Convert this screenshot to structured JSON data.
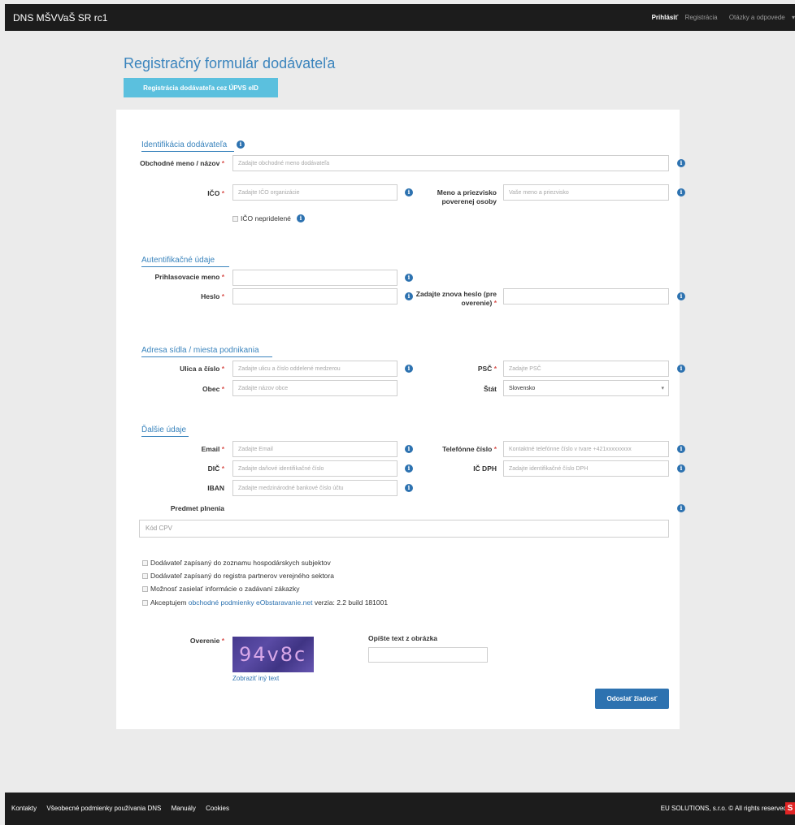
{
  "header": {
    "brand": "DNS MŠVVaŠ SR rc1",
    "nav": [
      "Prihlásiť",
      "Registrácia",
      "Otázky a odpovede"
    ],
    "dropdown_caret": "▾"
  },
  "page": {
    "title": "Registračný formulár dodávateľa",
    "eid_button": "Registrácia dodávateľa cez ÚPVS eID"
  },
  "sections": {
    "identification": {
      "title": "Identifikácia dodávateľa",
      "business_name_label": "Obchodné meno / názov",
      "business_name_placeholder": "Zadajte obchodné meno dodávateľa",
      "ico_label": "IČO",
      "ico_placeholder": "Zadajte IČO organizácie",
      "person_label": "Meno a priezvisko poverenej osoby",
      "person_placeholder": "Vaše meno a priezvisko",
      "ico_unassigned": "IČO nepridelené"
    },
    "auth": {
      "title": "Autentifikačné údaje",
      "login_label": "Prihlasovacie meno",
      "password_label": "Heslo",
      "password_repeat_label": "Zadajte znova heslo (pre overenie)"
    },
    "address": {
      "title": "Adresa sídla / miesta podnikania",
      "street_label": "Ulica a číslo",
      "street_placeholder": "Zadajte ulicu a číslo oddelené medzerou",
      "postal_label": "PSČ",
      "postal_placeholder": "Zadajte PSČ",
      "city_label": "Obec",
      "city_placeholder": "Zadajte názov obce",
      "country_label": "Štát",
      "country_value": "Slovensko"
    },
    "other": {
      "title": "Ďalšie údaje",
      "email_label": "Email",
      "email_placeholder": "Zadajte Email",
      "phone_label": "Telefónne číslo",
      "phone_placeholder": "Kontaktné telefónne číslo v tvare +421xxxxxxxxx",
      "dic_label": "DIČ",
      "dic_placeholder": "Zadajte daňové identifikačné číslo",
      "vat_label": "IČ DPH",
      "vat_placeholder": "Zadajte identifikačné číslo DPH",
      "iban_label": "IBAN",
      "iban_placeholder": "Zadajte medzinárodné bankové číslo účtu",
      "subject_label": "Predmet plnenia",
      "cpv_placeholder": "Kód CPV"
    }
  },
  "checkboxes": {
    "economic_register": "Dodávateľ zapísaný do zoznamu hospodárskych subjektov",
    "public_partners": "Dodávateľ zapísaný do registra partnerov verejného sektora",
    "notifications": "Možnosť zasielať informácie o zadávaní zákazky",
    "terms_prefix": "Akceptujem",
    "terms_link": "obchodné podmienky eObstaravanie.net",
    "terms_suffix": "verzia: 2.2 build 181001"
  },
  "captcha": {
    "label": "Overenie",
    "image_text": "94v8c",
    "refresh_link": "Zobraziť iný text",
    "instruction": "Opíšte text z obrázka"
  },
  "submit_label": "Odoslať žiadosť",
  "footer": {
    "links": [
      "Kontakty",
      "Všeobecné podmienky používania DNS",
      "Manuály",
      "Cookies"
    ],
    "copyright": "EU SOLUTIONS, s.r.o. © All rights reserved"
  },
  "required_marker": "*",
  "info_glyph": "i",
  "colors": {
    "accent": "#3a84bd",
    "button_primary": "#2d72b0",
    "button_info": "#5bc0de",
    "required": "#d9534f",
    "header": "#1c1c1c"
  }
}
